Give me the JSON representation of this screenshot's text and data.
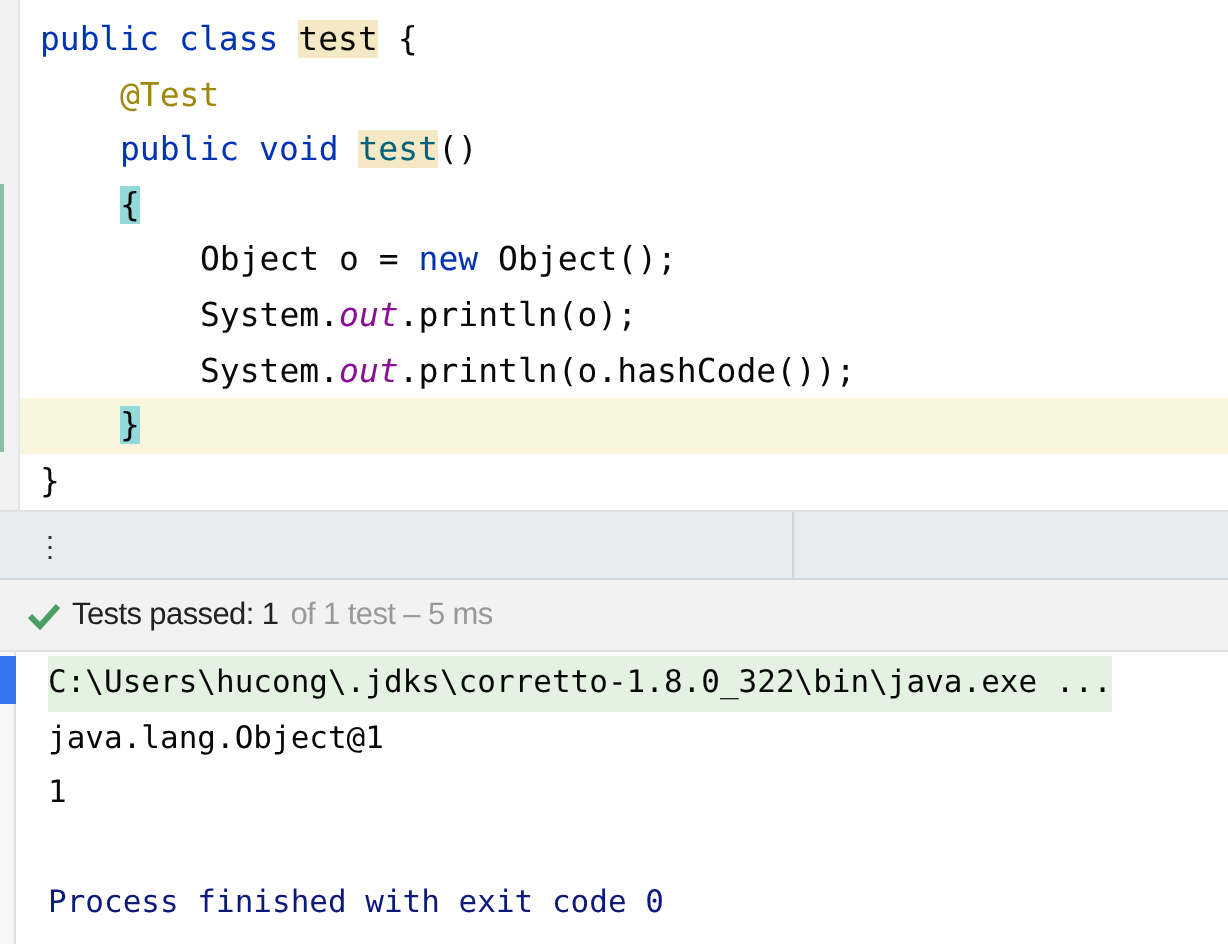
{
  "editor": {
    "lines": [
      {
        "current": false,
        "tokens": [
          {
            "kind": "keyword",
            "text": "public class "
          },
          {
            "kind": "usage",
            "text": "test"
          },
          {
            "kind": "plain",
            "text": " {"
          }
        ],
        "children": [
          {
            "current": false,
            "tokens": [
              {
                "kind": "annotation",
                "text": "@Test"
              }
            ]
          },
          {
            "current": false,
            "tokens": [
              {
                "kind": "keyword",
                "text": "public void "
              },
              {
                "kind": "usage-method",
                "text": "test"
              },
              {
                "kind": "plain",
                "text": "()"
              }
            ]
          },
          {
            "current": false,
            "tokens": [
              {
                "kind": "brace-match",
                "text": "{"
              }
            ],
            "children": [
              {
                "current": false,
                "tokens": [
                  {
                    "kind": "plain",
                    "text": "Object o = "
                  },
                  {
                    "kind": "keyword",
                    "text": "new"
                  },
                  {
                    "kind": "plain",
                    "text": " Object();"
                  }
                ]
              },
              {
                "current": false,
                "tokens": [
                  {
                    "kind": "plain",
                    "text": "System."
                  },
                  {
                    "kind": "field",
                    "text": "out"
                  },
                  {
                    "kind": "plain",
                    "text": ".println(o);"
                  }
                ]
              },
              {
                "current": false,
                "tokens": [
                  {
                    "kind": "plain",
                    "text": "System."
                  },
                  {
                    "kind": "field",
                    "text": "out"
                  },
                  {
                    "kind": "plain",
                    "text": ".println(o.hashCode());"
                  }
                ]
              }
            ]
          },
          {
            "current": true,
            "tokens": [
              {
                "kind": "brace-match",
                "text": "}"
              }
            ]
          }
        ]
      },
      {
        "current": false,
        "tokens": [
          {
            "kind": "plain",
            "text": "}"
          }
        ]
      }
    ]
  },
  "tool_strip": {
    "menu": "⋮"
  },
  "test_status": {
    "passed": true,
    "summary": "Tests passed: 1",
    "detail": "of 1 test – 5 ms"
  },
  "console": {
    "lines": [
      {
        "kind": "command",
        "text": "C:\\Users\\hucong\\.jdks\\corretto-1.8.0_322\\bin\\java.exe ..."
      },
      {
        "kind": "output",
        "text": "java.lang.Object@1"
      },
      {
        "kind": "output",
        "text": "1"
      },
      {
        "kind": "blank"
      },
      {
        "kind": "exit",
        "text": "Process finished with exit code 0"
      }
    ]
  }
}
